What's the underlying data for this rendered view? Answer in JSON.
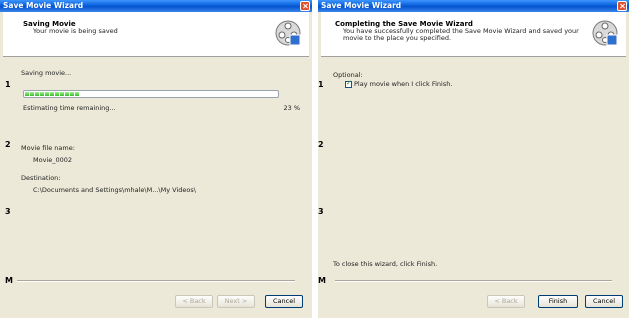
{
  "left_window": {
    "title": "Save Movie Wizard",
    "header_title": "Saving Movie",
    "header_subtitle": "Your movie is being saved",
    "status_text": "Saving movie...",
    "progress_percent": 23,
    "progress_label": "23 %",
    "estimate_label": "Estimating time remaining...",
    "filename_label": "Movie file name:",
    "filename_value": "Movie_0002",
    "destination_label": "Destination:",
    "destination_value": "C:\\Documents and Settings\\mhale\\M...\\My Videos\\",
    "buttons": {
      "back": "< Back",
      "next": "Next >",
      "cancel": "Cancel"
    }
  },
  "right_window": {
    "title": "Save Movie Wizard",
    "header_title": "Completing the Save Movie Wizard",
    "header_subtitle": "You have successfully completed the Save Movie Wizard and saved your movie to the place you specified.",
    "optional_label": "Optional:",
    "checkbox_label": "Play movie when I click Finish.",
    "checkbox_checked": true,
    "close_hint": "To close this wizard, click Finish.",
    "buttons": {
      "back": "< Back",
      "finish": "Finish",
      "cancel": "Cancel"
    }
  },
  "side_markers": [
    "1",
    "2",
    "3",
    "M"
  ],
  "icon": "film-reel-icon"
}
